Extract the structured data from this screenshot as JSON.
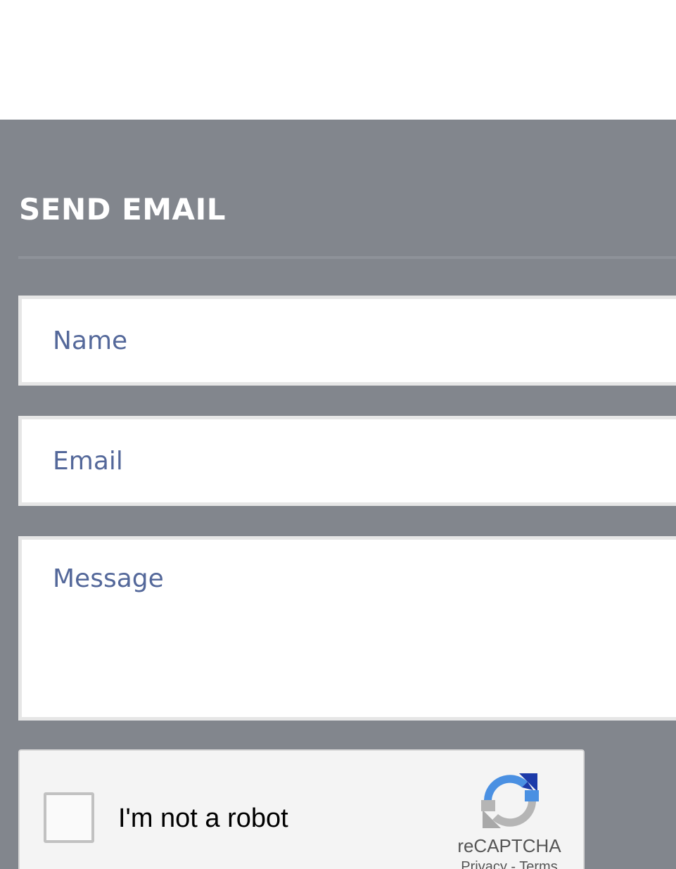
{
  "contact": {
    "title": "SEND EMAIL",
    "name_placeholder": "Name",
    "email_placeholder": "Email",
    "message_placeholder": "Message"
  },
  "recaptcha": {
    "label": "I'm not a robot",
    "brand": "reCAPTCHA",
    "privacy_label": "Privacy",
    "separator": " - ",
    "terms_label": "Terms"
  },
  "colors": {
    "section_background": "#82868d",
    "placeholder_text": "#54689a",
    "field_border": "#e6e6e6",
    "recaptcha_blue": "#4a90e2",
    "recaptcha_dark_blue": "#1c3aa9",
    "recaptcha_gray": "#b5b5b5"
  },
  "icons": {
    "recaptcha_logo": "recaptcha-logo-icon"
  }
}
